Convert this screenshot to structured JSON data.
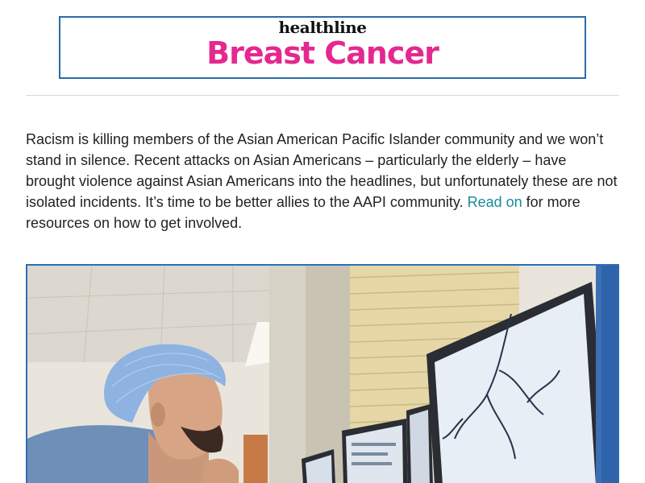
{
  "header": {
    "brand": "healthline",
    "newsletter_title": "Breast Cancer"
  },
  "intro": {
    "text": "Racism is killing members of the Asian American Pacific Islander community and we won’t stand in silence. Recent attacks on Asian Americans – particularly the elderly – have brought violence against Asian Americans into the headlines, but unfortunately these are not isolated incidents. It’s time to be better allies to the AAPI community. ",
    "link_text": "Read on",
    "tail_text": " for more resources on how to get involved."
  },
  "colors": {
    "brand_pink": "#e5288f",
    "link_teal": "#178c9a",
    "header_border": "#2c6aa6"
  }
}
